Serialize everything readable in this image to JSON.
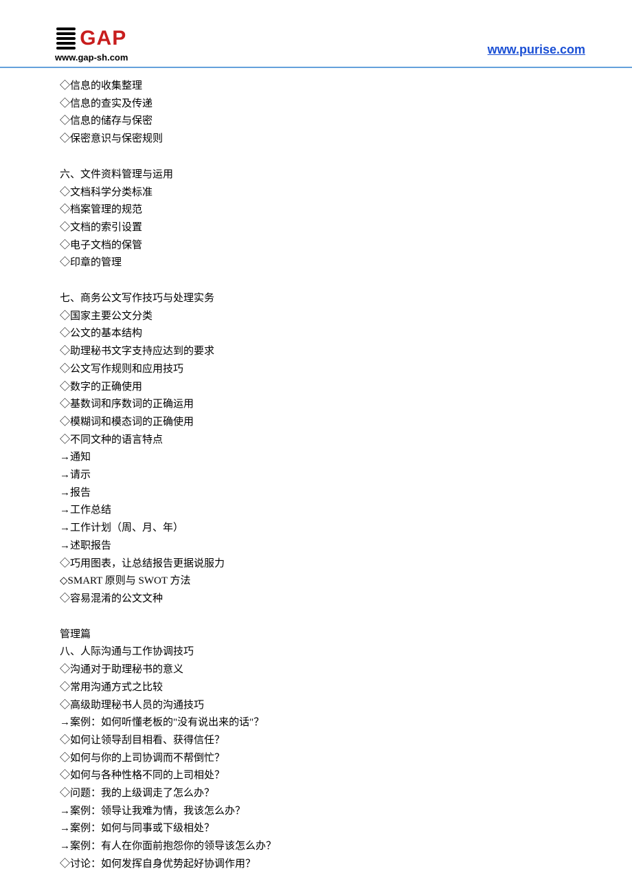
{
  "header": {
    "logo_brand": "GAP",
    "logo_url_text": "www.gap-sh.com",
    "header_link": "www.purise.com"
  },
  "content": {
    "lines": [
      "◇信息的收集整理",
      "◇信息的查实及传递",
      "◇信息的储存与保密",
      "◇保密意识与保密规则",
      "",
      "六、文件资料管理与运用",
      "◇文档科学分类标准",
      "◇档案管理的规范",
      "◇文档的索引设置",
      "◇电子文档的保管",
      "◇印章的管理",
      "",
      "七、商务公文写作技巧与处理实务",
      "◇国家主要公文分类",
      "◇公文的基本结构",
      "◇助理秘书文字支持应达到的要求",
      "◇公文写作规则和应用技巧",
      "◇数字的正确使用",
      "◇基数词和序数词的正确运用",
      "◇模糊词和模态词的正确使用",
      "◇不同文种的语言特点",
      "→通知",
      "→请示",
      "→报告",
      "→工作总结",
      "→工作计划（周、月、年）",
      "→述职报告",
      "◇巧用图表，让总结报告更据说服力",
      "◇SMART 原则与 SWOT 方法",
      "◇容易混淆的公文文种",
      "",
      "管理篇",
      "八、人际沟通与工作协调技巧",
      "◇沟通对于助理秘书的意义",
      "◇常用沟通方式之比较",
      "◇高级助理秘书人员的沟通技巧",
      "→案例：如何听懂老板的\"没有说出来的话\"？",
      "◇如何让领导刮目相看、获得信任？",
      "◇如何与你的上司协调而不帮倒忙？",
      "◇如何与各种性格不同的上司相处？",
      "◇问题：我的上级调走了怎么办？",
      "→案例：领导让我难为情，我该怎么办？",
      "→案例：如何与同事或下级相处？",
      "→案例：有人在你面前抱怨你的领导该怎么办？",
      "◇讨论：如何发挥自身优势起好协调作用？"
    ]
  }
}
